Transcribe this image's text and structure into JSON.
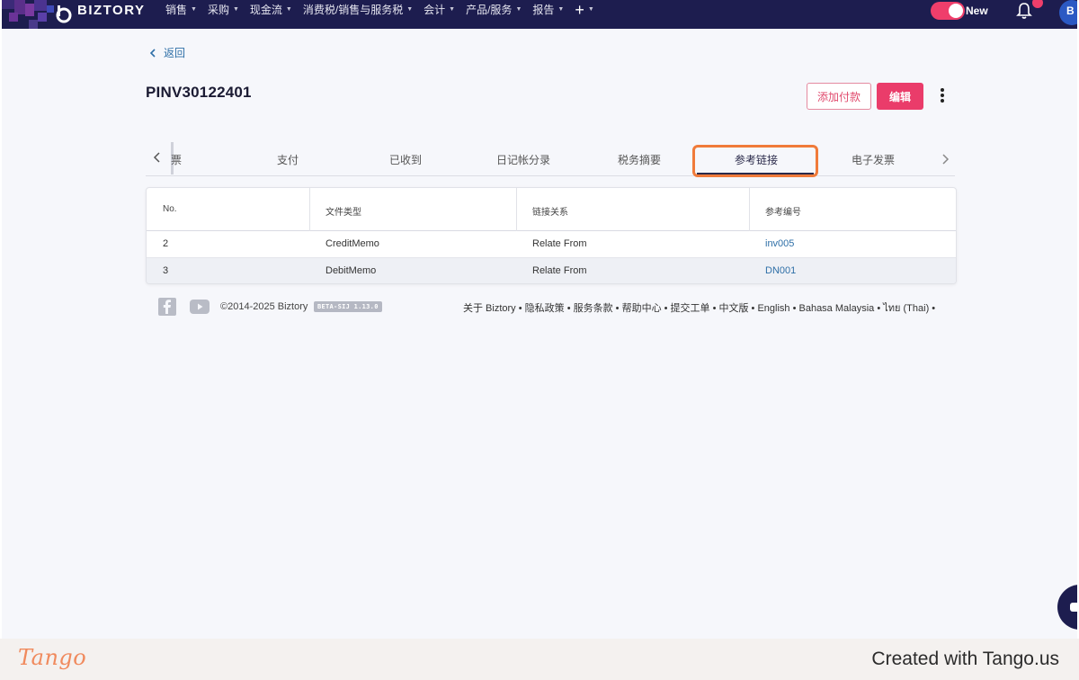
{
  "nav": {
    "brand": "BIZTORY",
    "menu": [
      {
        "label": "销售",
        "has_caret": true
      },
      {
        "label": "采购",
        "has_caret": true
      },
      {
        "label": "现金流",
        "has_caret": true
      },
      {
        "label": "消费税/销售与服务税",
        "has_caret": true
      },
      {
        "label": "会计",
        "has_caret": true
      },
      {
        "label": "产品/服务",
        "has_caret": true
      },
      {
        "label": "报告",
        "has_caret": true
      }
    ],
    "plus_icon": "plus-icon",
    "toggle_label": "New",
    "toggle_on": true,
    "avatar_initial": "B",
    "brand_color": "#1d1d4f",
    "accent_color": "#ef3e6b"
  },
  "page": {
    "back_label": "返回",
    "title": "PINV30122401",
    "add_payment_label": "添加付款",
    "edit_label": "编辑"
  },
  "tabs": {
    "items": [
      "票",
      "支付",
      "已收到",
      "日记帐分录",
      "税务摘要",
      "参考链接",
      "电子发票"
    ],
    "active": "参考链接"
  },
  "table": {
    "headers": [
      "No.",
      "文件类型",
      "链接关系",
      "参考编号"
    ],
    "rows": [
      {
        "no": "2",
        "doc_type": "CreditMemo",
        "relation": "Relate From",
        "ref": "inv005"
      },
      {
        "no": "3",
        "doc_type": "DebitMemo",
        "relation": "Relate From",
        "ref": "DN001"
      }
    ]
  },
  "footer": {
    "copyright": "©2014-2025 Biztory",
    "version_badge": "BETA-SIJ 1.13.0",
    "links": "关于 Biztory • 隐私政策 • 服务条款 • 帮助中心 • 提交工单 • 中文版 • English • Bahasa Malaysia • ไทย (Thai) •"
  },
  "watermark": {
    "logo": "Tango",
    "credit": "Created with Tango.us"
  }
}
